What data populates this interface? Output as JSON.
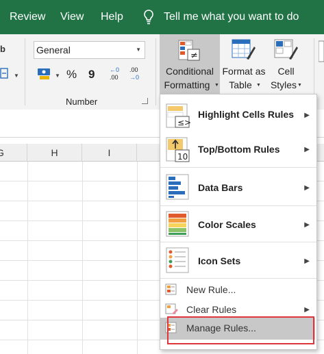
{
  "tabs": {
    "review": "Review",
    "view": "View",
    "help": "Help",
    "tell_me": "Tell me what you want to do"
  },
  "number_group": {
    "format_value": "General",
    "symbols": {
      "currency": "$",
      "percent": "%",
      "comma": "9",
      "inc_dec_top": "←0",
      "inc_dec_bottom": ".00",
      "dec_dec_top": ".00",
      "dec_dec_bottom": "→0"
    },
    "label": "Number"
  },
  "styles_group": {
    "conditional_formatting": {
      "line1": "Conditional",
      "line2": "Formatting"
    },
    "format_as_table": {
      "line1": "Format as",
      "line2": "Table"
    },
    "cell_styles": {
      "line1": "Cell",
      "line2": "Styles"
    }
  },
  "columns": [
    "G",
    "H",
    "I"
  ],
  "menu": {
    "items": [
      {
        "label": "Highlight Cells Rules",
        "icon": "highlight-cells-icon"
      },
      {
        "label": "Top/Bottom Rules",
        "icon": "top-bottom-icon"
      },
      {
        "label": "Data Bars",
        "icon": "data-bars-icon"
      },
      {
        "label": "Color Scales",
        "icon": "color-scales-icon"
      },
      {
        "label": "Icon Sets",
        "icon": "icon-sets-icon"
      }
    ],
    "commands": [
      {
        "label": "New Rule..."
      },
      {
        "label": "Clear Rules"
      },
      {
        "label": "Manage Rules..."
      }
    ]
  },
  "colors": {
    "ribbon_tab": "#217346",
    "highlight": "#c8c8c8",
    "callout": "#e0353b"
  }
}
